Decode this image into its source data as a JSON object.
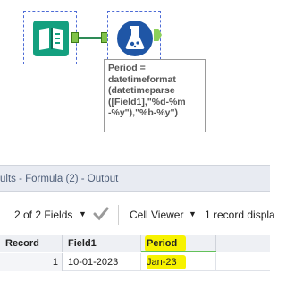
{
  "workflow": {
    "annotation": "Period =\ndatetimeformat\n(datetimeparse\n([Field1],\"%d-%m\n-%y\"),\"%b-%y\")"
  },
  "results": {
    "title": "ults - Formula (2) - Output",
    "toolbar": {
      "fields_label": "2 of 2 Fields",
      "viewer_label": "Cell Viewer",
      "record_count": "1 record displa"
    },
    "columns": [
      "Record",
      "Field1",
      "Period"
    ],
    "rows": [
      {
        "record": "1",
        "field1": "10-01-2023",
        "period": "Jan-23"
      }
    ],
    "highlight_color": "#f7f200"
  }
}
